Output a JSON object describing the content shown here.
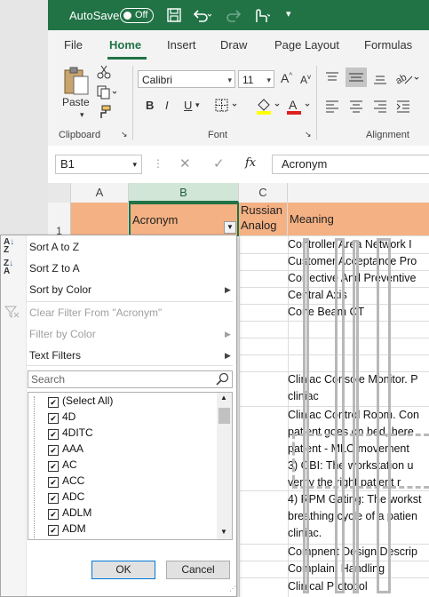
{
  "titlebar": {
    "autosave_label": "AutoSave",
    "autosave_state": "Off",
    "more": "▾"
  },
  "ribbon_tabs": [
    "File",
    "Home",
    "Insert",
    "Draw",
    "Page Layout",
    "Formulas"
  ],
  "ribbon": {
    "paste_label": "Paste",
    "clipboard_label": "Clipboard",
    "font_label": "Font",
    "alignment_label": "Alignment",
    "font_name": "Calibri",
    "font_size": "11",
    "bold": "B",
    "italic": "I",
    "underline": "U"
  },
  "formula_bar": {
    "name_box": "B1",
    "fx": "fx",
    "content": "Acronym"
  },
  "columns": [
    "A",
    "B",
    "C"
  ],
  "sheet": {
    "row1_number": "1",
    "b1": "Acronym",
    "c1_line1": "Russian",
    "c1_line2": "Analog",
    "d1": "Meaning",
    "meanings": [
      "Controller Area Network I",
      "Customer Acceptance Pro",
      "Corrective And Preventive",
      "Central Axis",
      "Cone Beam CT",
      "Cliniac Console Monitor. P",
      "cliniac",
      "Cliniac Control Room. Con",
      "patient goes on bed, here",
      "patient - MLC movement",
      "3) OBI: The workstation u",
      "verify the right patient r",
      "4) RPM Gating: The workst",
      "breathing cycle of a patien",
      "cliniac.",
      "Compnent Design Descrip",
      "Complaint Handling",
      "Clinical Protocol"
    ]
  },
  "filter_menu": {
    "sort_az": "Sort A to Z",
    "sort_za": "Sort Z to A",
    "sort_color": "Sort by Color",
    "clear_filter": "Clear Filter From \"Acronym\"",
    "filter_color": "Filter by Color",
    "text_filters": "Text Filters",
    "search_placeholder": "Search",
    "items": [
      "(Select All)",
      "4D",
      "4DITC",
      "AAA",
      "AC",
      "ACC",
      "ADC",
      "ADLM",
      "ADM"
    ],
    "ok": "OK",
    "cancel": "Cancel"
  },
  "colors": {
    "excel_green": "#217346",
    "header_orange": "#f4b183"
  }
}
